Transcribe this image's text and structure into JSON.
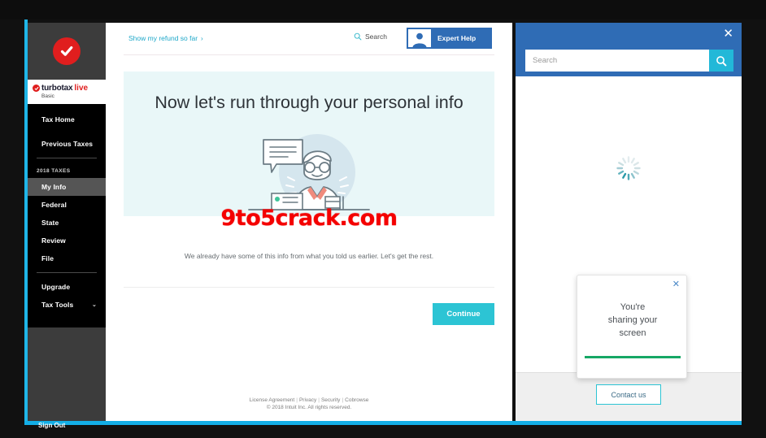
{
  "window": {
    "frame_accent_color": "#13aee6",
    "backdrop_color": "#0d0d0d"
  },
  "sidebar": {
    "logo_icon": "red-check-circle-icon",
    "brand": {
      "mark_icon": "turbotax-check-icon",
      "name": "turbotax",
      "edition": "live",
      "tier": "Basic"
    },
    "top_items": [
      {
        "label": "Tax Home",
        "active": false
      },
      {
        "label": "Previous Taxes",
        "active": false
      }
    ],
    "section_label": "2018 TAXES",
    "items": [
      {
        "label": "My Info",
        "active": true
      },
      {
        "label": "Federal",
        "active": false
      },
      {
        "label": "State",
        "active": false
      },
      {
        "label": "Review",
        "active": false
      },
      {
        "label": "File",
        "active": false
      }
    ],
    "utility_items": [
      {
        "label": "Upgrade",
        "chevron": false
      },
      {
        "label": "Tax Tools",
        "chevron": true
      }
    ],
    "chevron_glyph": "⌄",
    "sign_out_label": "Sign Out",
    "nav_background": "#000000",
    "panel_background": "#3c3c3c"
  },
  "topbar": {
    "refund_link": "Show my refund so far",
    "refund_chevron": "›",
    "search_label": "Search",
    "search_icon": "search-icon",
    "expert_help_label": "Expert Help",
    "expert_help_avatar_icon": "agent-avatar-icon",
    "expert_help_color": "#2f6cb5"
  },
  "main": {
    "hero_background": "#e9f7f8",
    "title": "Now let's run through your personal info",
    "illustration_icon": "person-with-speech-bubble-illustration",
    "subtitle": "We already have some of this info from what you told us earlier. Let's get the rest.",
    "continue_label": "Continue",
    "continue_color": "#2cc4d4"
  },
  "watermark": {
    "text": "9to5crack.com",
    "color": "#f40000"
  },
  "footer": {
    "links": [
      "License Agreement",
      "Privacy",
      "Security",
      "Cobrowse"
    ],
    "separator": "|",
    "copyright": "© 2018 Intuit Inc. All rights reserved."
  },
  "right_panel": {
    "header_color": "#2f6cb5",
    "close_icon": "close-icon",
    "close_glyph": "✕",
    "search_placeholder": "Search",
    "search_value": "",
    "search_button_icon": "search-icon",
    "search_button_color": "#22b8d8",
    "loading_spinner_icon": "loading-spinner-icon",
    "spinner_color": "#2a9aa8",
    "contact_label": "Contact us",
    "contact_border_color": "#2cc4d4"
  },
  "share_card": {
    "close_icon": "close-icon",
    "close_glyph": "✕",
    "line1": "You're",
    "line2": "sharing your",
    "line3": "screen",
    "progress_color": "#16a765",
    "progress_percent": 100
  }
}
